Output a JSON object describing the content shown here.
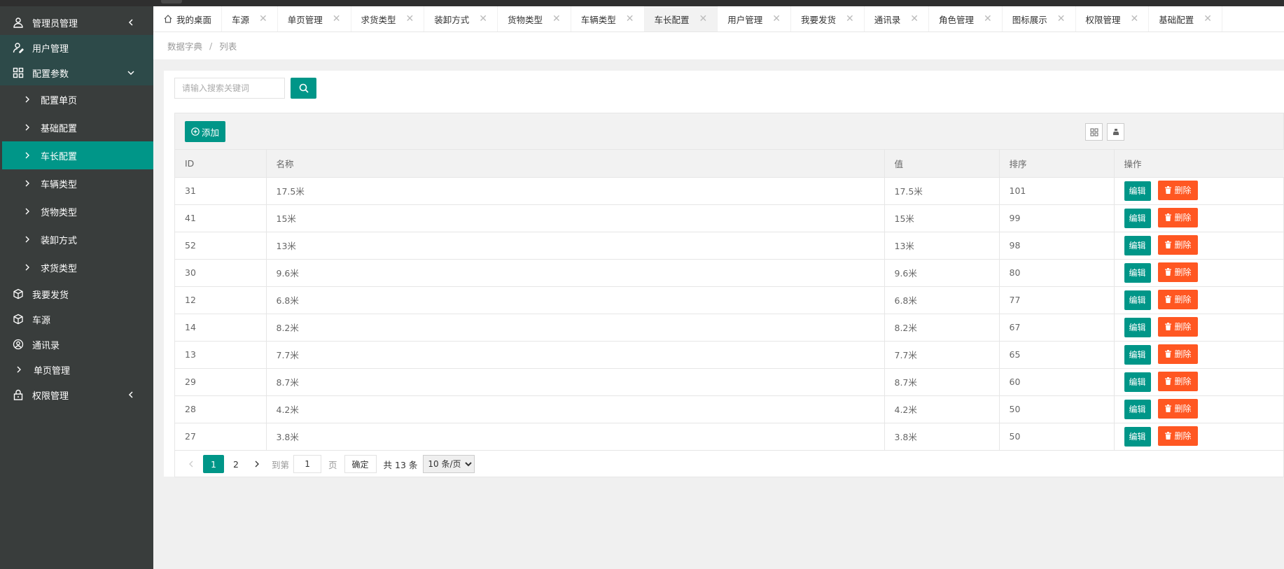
{
  "sidebar": {
    "items": [
      {
        "label": "管理员管理",
        "icon": "user-icon"
      },
      {
        "label": "用户管理",
        "icon": "user-edit-icon"
      },
      {
        "label": "配置参数",
        "icon": "grid-icon"
      }
    ],
    "sub_items": [
      {
        "label": "配置单页"
      },
      {
        "label": "基础配置"
      },
      {
        "label": "车长配置"
      },
      {
        "label": "车辆类型"
      },
      {
        "label": "货物类型"
      },
      {
        "label": "装卸方式"
      },
      {
        "label": "求货类型"
      }
    ],
    "items_after": [
      {
        "label": "我要发货",
        "icon": "cube-icon"
      },
      {
        "label": "车源",
        "icon": "cube-icon"
      },
      {
        "label": "通讯录",
        "icon": "contact-icon"
      },
      {
        "label": "单页管理",
        "icon": "chevron-right-icon"
      },
      {
        "label": "权限管理",
        "icon": "lock-icon"
      }
    ]
  },
  "tabs": [
    {
      "label": "我的桌面",
      "home": true
    },
    {
      "label": "车源"
    },
    {
      "label": "单页管理"
    },
    {
      "label": "求货类型"
    },
    {
      "label": "装卸方式"
    },
    {
      "label": "货物类型"
    },
    {
      "label": "车辆类型"
    },
    {
      "label": "车长配置",
      "active": true
    },
    {
      "label": "用户管理"
    },
    {
      "label": "我要发货"
    },
    {
      "label": "通讯录"
    },
    {
      "label": "角色管理"
    },
    {
      "label": "图标展示"
    },
    {
      "label": "权限管理"
    },
    {
      "label": "基础配置"
    }
  ],
  "breadcrumb": {
    "parent": "数据字典",
    "sep": "/",
    "current": "列表"
  },
  "search": {
    "placeholder": "请输入搜索关键词"
  },
  "toolbar": {
    "add_label": "添加"
  },
  "table": {
    "headers": {
      "id": "ID",
      "name": "名称",
      "value": "值",
      "sort": "排序",
      "op": "操作"
    },
    "edit_label": "编辑",
    "delete_label": "删除",
    "rows": [
      {
        "id": "31",
        "name": "17.5米",
        "value": "17.5米",
        "sort": "101"
      },
      {
        "id": "41",
        "name": "15米",
        "value": "15米",
        "sort": "99"
      },
      {
        "id": "52",
        "name": "13米",
        "value": "13米",
        "sort": "98"
      },
      {
        "id": "30",
        "name": "9.6米",
        "value": "9.6米",
        "sort": "80"
      },
      {
        "id": "12",
        "name": "6.8米",
        "value": "6.8米",
        "sort": "77"
      },
      {
        "id": "14",
        "name": "8.2米",
        "value": "8.2米",
        "sort": "67"
      },
      {
        "id": "13",
        "name": "7.7米",
        "value": "7.7米",
        "sort": "65"
      },
      {
        "id": "29",
        "name": "8.7米",
        "value": "8.7米",
        "sort": "60"
      },
      {
        "id": "28",
        "name": "4.2米",
        "value": "4.2米",
        "sort": "50"
      },
      {
        "id": "27",
        "name": "3.8米",
        "value": "3.8米",
        "sort": "50"
      }
    ]
  },
  "pager": {
    "pages": [
      "1",
      "2"
    ],
    "current_page": "1",
    "goto_label": "到第",
    "goto_value": "1",
    "page_label": "页",
    "confirm_label": "确定",
    "total_label": "共 13 条",
    "size_option": "10 条/页"
  },
  "colors": {
    "accent": "#009688",
    "danger": "#ff5722",
    "sidebar": "#393d3c"
  }
}
